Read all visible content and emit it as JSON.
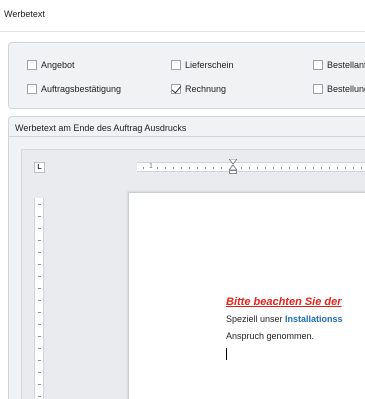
{
  "header": {
    "title": "Werbetext"
  },
  "options": {
    "items": [
      {
        "label": "Angebot",
        "checked": false
      },
      {
        "label": "Lieferschein",
        "checked": false
      },
      {
        "label": "Bestellanfı",
        "checked": false
      },
      {
        "label": "Auftragsbestätigung",
        "checked": false
      },
      {
        "label": "Rechnung",
        "checked": true
      },
      {
        "label": "Bestellung",
        "checked": false
      }
    ]
  },
  "editor": {
    "title": "Werbetext am Ende des Auftrag Ausdrucks",
    "ruler_label": "1",
    "document": {
      "heading": "Bitte beachten Sie der",
      "line1_prefix": "Speziell unser ",
      "line1_highlight": "Installationss",
      "line2": "Anspruch genommen."
    }
  }
}
